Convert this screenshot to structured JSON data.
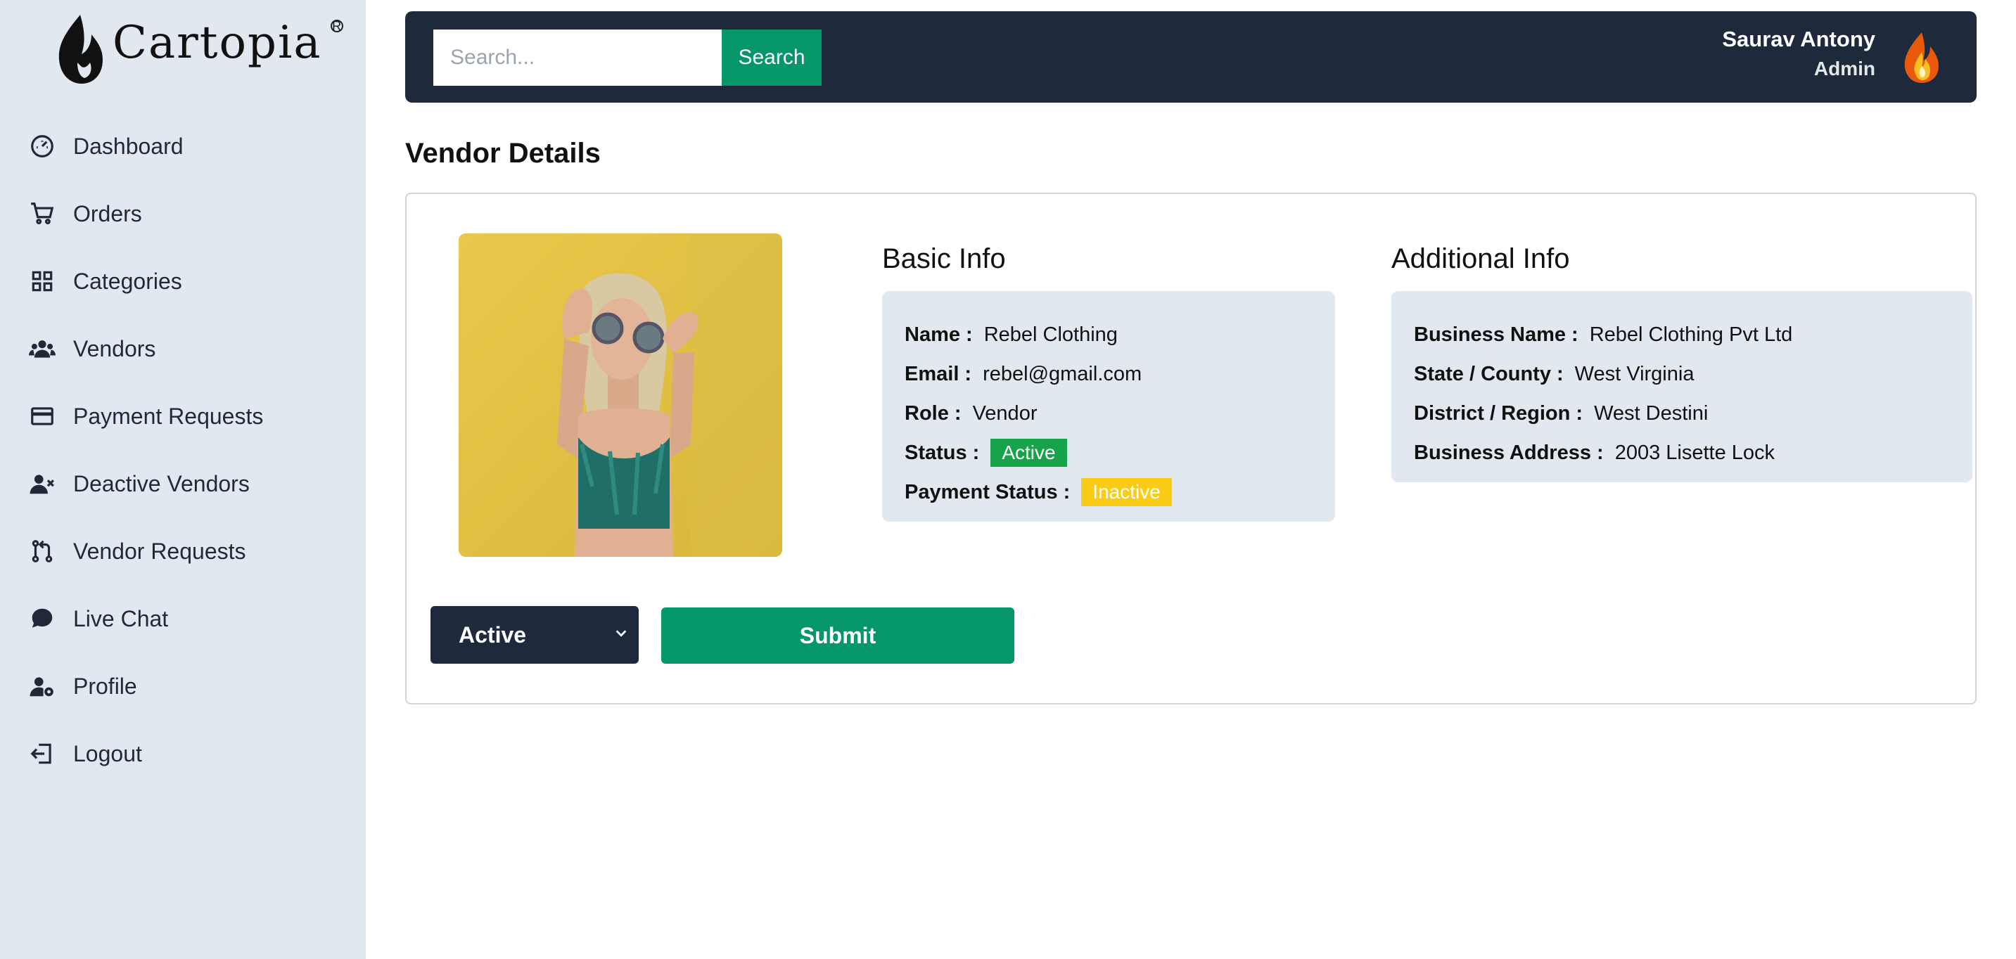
{
  "app": {
    "name": "Cartopia",
    "registered_mark": "R"
  },
  "sidebar": {
    "items": [
      {
        "label": "Dashboard",
        "icon": "gauge-icon"
      },
      {
        "label": "Orders",
        "icon": "cart-icon"
      },
      {
        "label": "Categories",
        "icon": "grid-icon"
      },
      {
        "label": "Vendors",
        "icon": "users-icon"
      },
      {
        "label": "Payment Requests",
        "icon": "credit-card-icon"
      },
      {
        "label": "Deactive Vendors",
        "icon": "user-x-icon"
      },
      {
        "label": "Vendor Requests",
        "icon": "git-pull-request-icon"
      },
      {
        "label": "Live Chat",
        "icon": "chat-icon"
      },
      {
        "label": "Profile",
        "icon": "user-gear-icon"
      },
      {
        "label": "Logout",
        "icon": "logout-icon"
      }
    ]
  },
  "header": {
    "search": {
      "placeholder": "Search...",
      "value": ""
    },
    "search_button": "Search",
    "user": {
      "name": "Saurav Antony",
      "role": "Admin",
      "avatar_icon": "flame-icon"
    }
  },
  "page": {
    "title": "Vendor Details"
  },
  "vendor": {
    "basic_info": {
      "title": "Basic Info",
      "name_label": "Name :",
      "name": "Rebel Clothing",
      "email_label": "Email :",
      "email": "rebel@gmail.com",
      "role_label": "Role :",
      "role": "Vendor",
      "status_label": "Status :",
      "status": "Active",
      "payment_status_label": "Payment Status :",
      "payment_status": "Inactive"
    },
    "additional_info": {
      "title": "Additional Info",
      "business_name_label": "Business Name :",
      "business_name": "Rebel Clothing Pvt Ltd",
      "state_label": "State / County :",
      "state": "West Virginia",
      "district_label": "District / Region :",
      "district": "West Destini",
      "address_label": "Business Address :",
      "address": "2003 Lisette Lock"
    }
  },
  "actions": {
    "status_select": "Active",
    "submit": "Submit"
  },
  "colors": {
    "sidebar_bg": "#e2e8f0",
    "header_bg": "#1e293b",
    "accent": "#059669",
    "active_badge": "#16a34a",
    "inactive_badge": "#facc15"
  }
}
